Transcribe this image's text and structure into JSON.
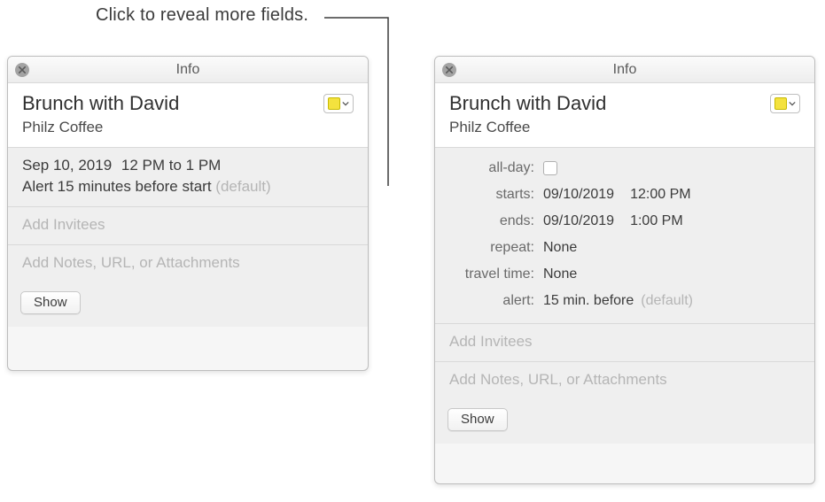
{
  "callout": "Click to reveal more fields.",
  "left": {
    "title": "Info",
    "event_title": "Brunch with David",
    "event_location": "Philz Coffee",
    "date": "Sep 10, 2019",
    "time_range": "12 PM to 1 PM",
    "alert_text": "Alert 15 minutes before start",
    "alert_default": "(default)",
    "invitees_placeholder": "Add Invitees",
    "notes_placeholder": "Add Notes, URL, or Attachments",
    "show_button": "Show"
  },
  "right": {
    "title": "Info",
    "event_title": "Brunch with David",
    "event_location": "Philz Coffee",
    "rows": {
      "allday_label": "all-day:",
      "starts_label": "starts:",
      "starts_date": "09/10/2019",
      "starts_time": "12:00 PM",
      "ends_label": "ends:",
      "ends_date": "09/10/2019",
      "ends_time": "1:00 PM",
      "repeat_label": "repeat:",
      "repeat_value": "None",
      "travel_label": "travel time:",
      "travel_value": "None",
      "alert_label": "alert:",
      "alert_value": "15 min. before",
      "alert_default": "(default)"
    },
    "invitees_placeholder": "Add Invitees",
    "notes_placeholder": "Add Notes, URL, or Attachments",
    "show_button": "Show"
  },
  "color_chip": "#f4e23e"
}
